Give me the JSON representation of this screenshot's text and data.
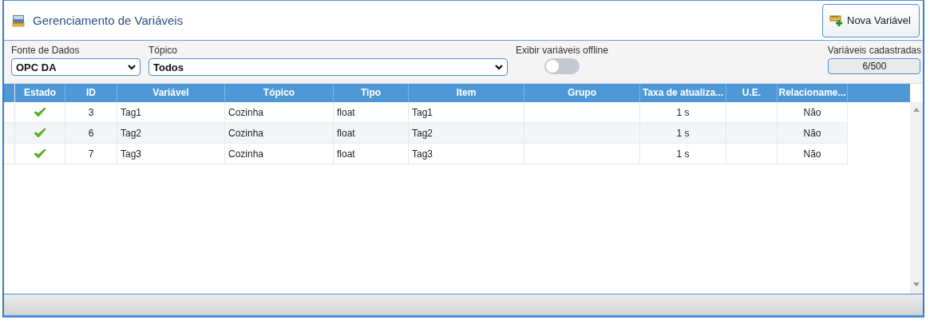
{
  "window": {
    "title": "Gerenciamento de Variáveis"
  },
  "new_button": {
    "label": "Nova Variável"
  },
  "filters": {
    "data_source": {
      "label": "Fonte de Dados",
      "value": "OPC DA"
    },
    "topic": {
      "label": "Tópico",
      "value": "Todos"
    },
    "show_offline": {
      "label": "Exibir variáveis offline",
      "on": false
    },
    "registered": {
      "label": "Variáveis cadastradas",
      "value": "6/500"
    }
  },
  "table": {
    "columns": [
      "Estado",
      "ID",
      "Variável",
      "Tópico",
      "Tipo",
      "Item",
      "Grupo",
      "Taxa de atualiza...",
      "U.E.",
      "Relacioname..."
    ],
    "rows": [
      {
        "online": true,
        "id": "3",
        "variable": "Tag1",
        "topic": "Cozinha",
        "type": "float",
        "item": "Tag1",
        "rate": "1 s",
        "relationship": "Não"
      },
      {
        "online": true,
        "id": "6",
        "variable": "Tag2",
        "topic": "Cozinha",
        "type": "float",
        "item": "Tag2",
        "rate": "1 s",
        "relationship": "Não"
      },
      {
        "online": true,
        "id": "7",
        "variable": "Tag3",
        "topic": "Cozinha",
        "type": "float",
        "item": "Tag3",
        "rate": "1 s",
        "relationship": "Não"
      }
    ]
  }
}
